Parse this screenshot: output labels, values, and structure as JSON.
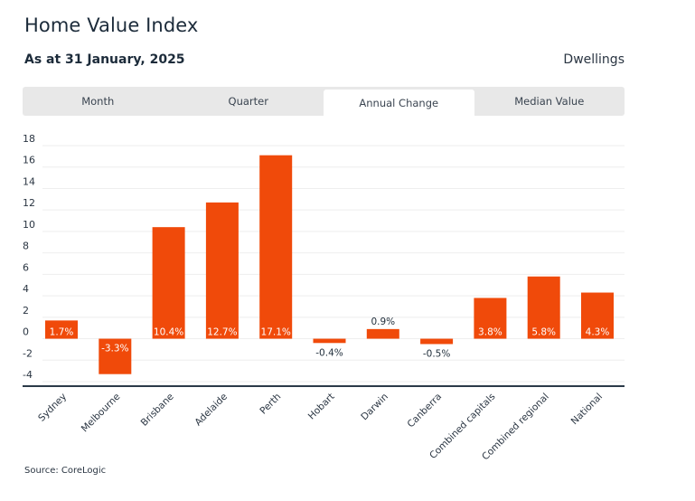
{
  "header": {
    "title": "Home Value Index",
    "subtitle": "As at 31 January, 2025",
    "property_type": "Dwellings"
  },
  "tabs": [
    {
      "label": "Month",
      "active": false
    },
    {
      "label": "Quarter",
      "active": false
    },
    {
      "label": "Annual Change",
      "active": true
    },
    {
      "label": "Median Value",
      "active": false
    }
  ],
  "footer": {
    "source": "Source: CoreLogic"
  },
  "colors": {
    "bar": "#f04a0a",
    "gridline": "#eeeeee",
    "axis": "#2b3a48"
  },
  "chart_data": {
    "type": "bar",
    "title": "Home Value Index",
    "xlabel": "",
    "ylabel": "",
    "ylim": [
      -4,
      18
    ],
    "yticks": [
      18,
      16,
      14,
      12,
      10,
      8,
      6,
      4,
      2,
      0,
      -2,
      -4
    ],
    "grid": true,
    "categories": [
      "Sydney",
      "Melbourne",
      "Brisbane",
      "Adelaide",
      "Perth",
      "Hobart",
      "Darwin",
      "Canberra",
      "Combined capitals",
      "Combined regional",
      "National"
    ],
    "values": [
      1.7,
      -3.3,
      10.4,
      12.7,
      17.1,
      -0.4,
      0.9,
      -0.5,
      3.8,
      5.8,
      4.3
    ],
    "data_labels": [
      "1.7%",
      "-3.3%",
      "10.4%",
      "12.7%",
      "17.1%",
      "-0.4%",
      "0.9%",
      "-0.5%",
      "3.8%",
      "5.8%",
      "4.3%"
    ],
    "legend": "none"
  }
}
